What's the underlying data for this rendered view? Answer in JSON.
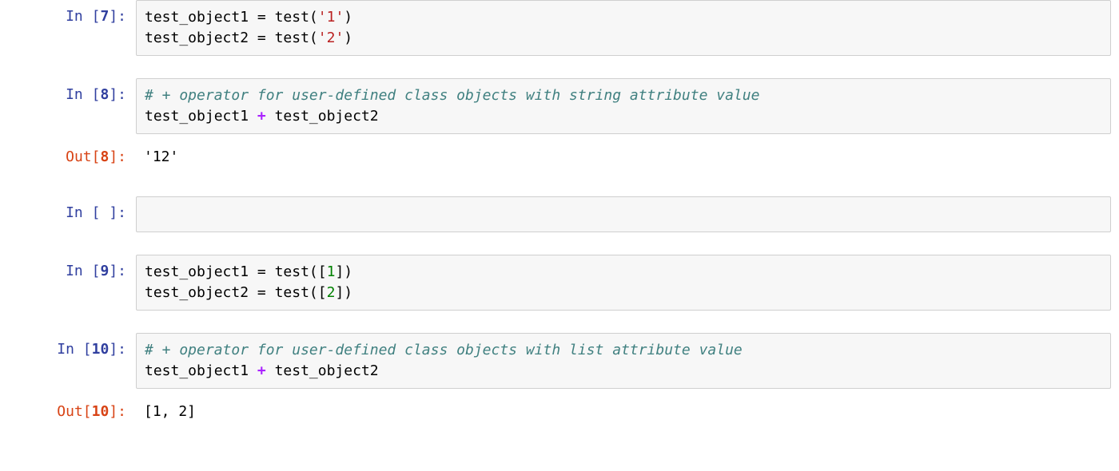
{
  "labels": {
    "in": "In",
    "out": "Out"
  },
  "cells": {
    "c7": {
      "prompt_num": "7",
      "line1": {
        "lhs": "test_object1",
        "assign": " = ",
        "func": "test",
        "lparen": "(",
        "arg": "'1'",
        "rparen": ")"
      },
      "line2": {
        "lhs": "test_object2",
        "assign": " = ",
        "func": "test",
        "lparen": "(",
        "arg": "'2'",
        "rparen": ")"
      }
    },
    "c8": {
      "prompt_num": "8",
      "comment": "# + operator for user-defined class objects with string attribute value",
      "expr": {
        "a": "test_object1",
        "op": " + ",
        "b": "test_object2"
      },
      "out": "'12'"
    },
    "cE": {
      "prompt_num": " "
    },
    "c9": {
      "prompt_num": "9",
      "line1": {
        "lhs": "test_object1",
        "assign": " = ",
        "func": "test",
        "lparen": "([",
        "arg": "1",
        "rparen": "])"
      },
      "line2": {
        "lhs": "test_object2",
        "assign": " = ",
        "func": "test",
        "lparen": "([",
        "arg": "2",
        "rparen": "])"
      }
    },
    "c10": {
      "prompt_num": "10",
      "comment": "# + operator for user-defined class objects with list attribute value",
      "expr": {
        "a": "test_object1",
        "op": " + ",
        "b": "test_object2"
      },
      "out": "[1, 2]"
    }
  }
}
